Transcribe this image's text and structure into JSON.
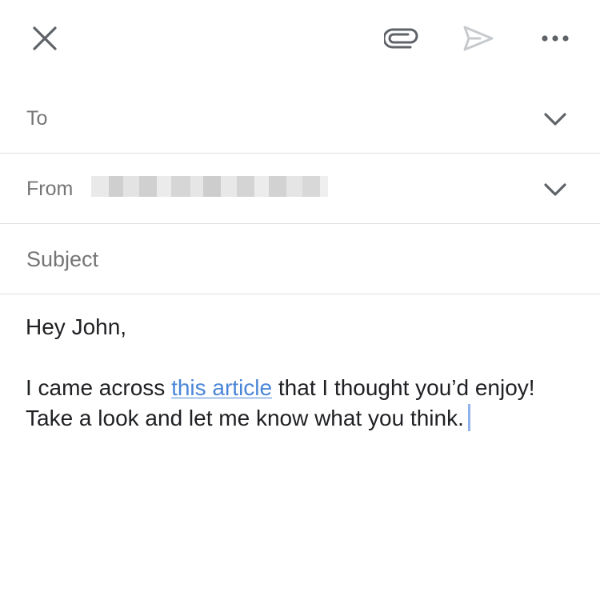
{
  "toolbar": {
    "close_icon": "close-icon",
    "attach_icon": "paperclip-icon",
    "send_icon": "send-icon",
    "more_icon": "more-horizontal-icon"
  },
  "fields": {
    "to_label": "To",
    "from_label": "From",
    "from_value_redacted": true,
    "subject_label": "Subject"
  },
  "body": {
    "greeting": "Hey John,",
    "line_before_link": "I came across ",
    "link_text": "this article",
    "line_after_link": " that I thought you’d enjoy! Take a look and let me know what you think."
  },
  "colors": {
    "link": "#4a86d8",
    "caret": "#8fb2ee",
    "label": "#757575",
    "divider": "#e0e0e0",
    "icon": "#5f6368",
    "send_disabled": "#c7cacd"
  }
}
